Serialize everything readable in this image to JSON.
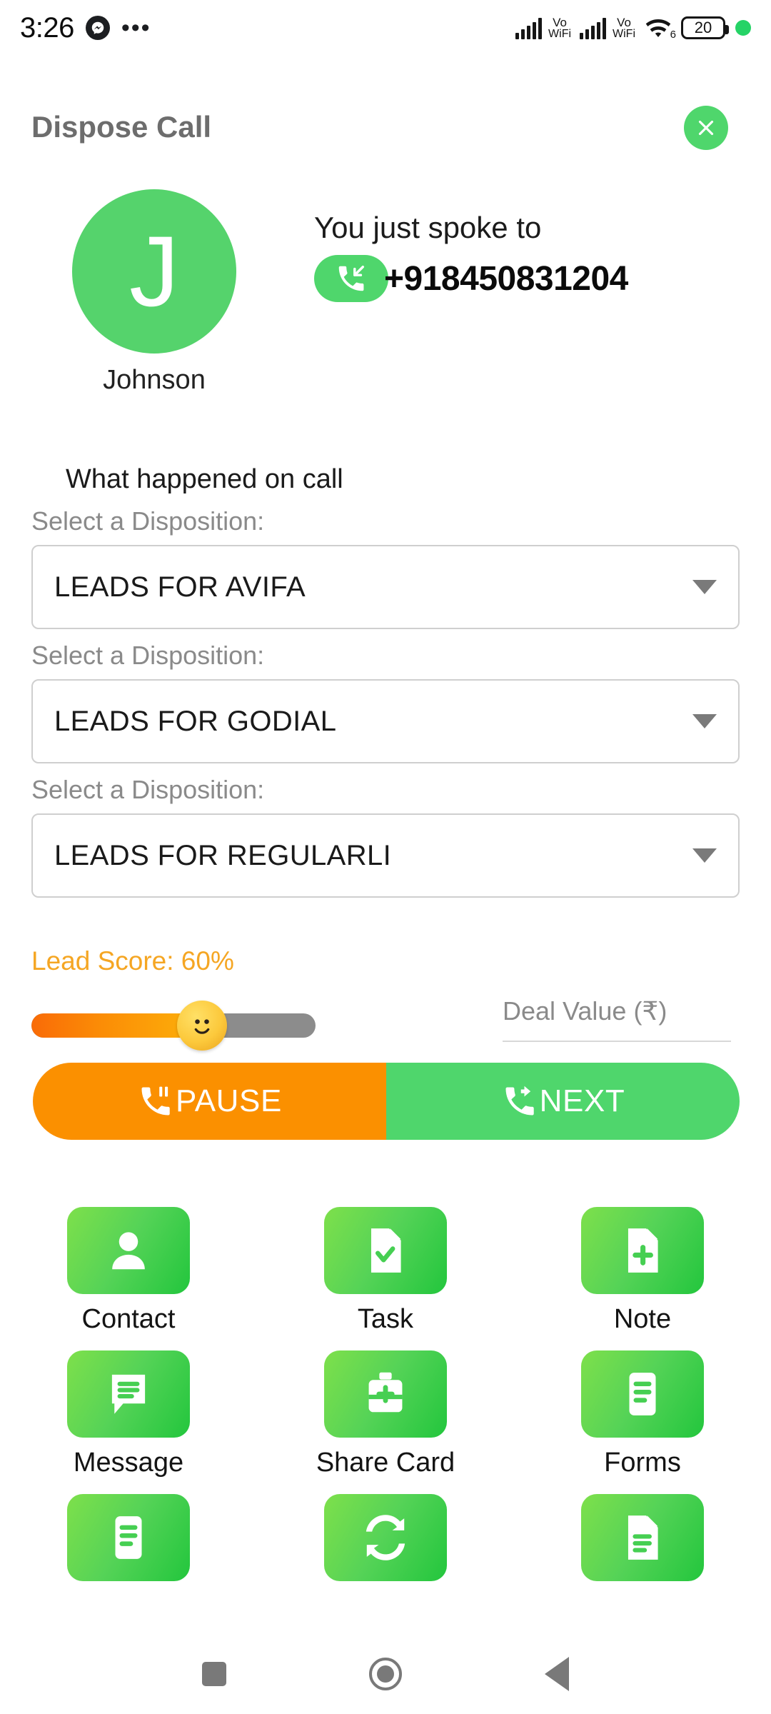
{
  "status_bar": {
    "time": "3:26",
    "messenger_icon": "messenger-icon",
    "overflow_icon": "more-dots-icon",
    "signal_1": {
      "label_top": "Vo",
      "label_bottom": "WiFi"
    },
    "signal_2": {
      "label_top": "Vo",
      "label_bottom": "WiFi"
    },
    "wifi": {
      "icon": "wifi-icon",
      "generation": "6"
    },
    "battery": {
      "level": "20"
    },
    "recording_dot": "green-status-dot"
  },
  "header": {
    "title": "Dispose Call",
    "close_label": "close-icon"
  },
  "caller": {
    "avatar_initial": "J",
    "name": "Johnson",
    "spoke_to_label": "You just spoke to",
    "phone_number": "+918450831204",
    "call_direction_icon": "incoming-call-icon"
  },
  "form": {
    "section_title": "What happened on call",
    "dispositions": [
      {
        "label": "Select a Disposition:",
        "value": "LEADS FOR AVIFA"
      },
      {
        "label": "Select a Disposition:",
        "value": "LEADS FOR GODIAL"
      },
      {
        "label": "Select a Disposition:",
        "value": "LEADS FOR REGULARLI"
      }
    ]
  },
  "lead": {
    "score_label": "Lead Score: 60%",
    "score_percent": 60,
    "deal_value_label": "Deal Value (₹)",
    "deal_value": ""
  },
  "actions": {
    "pause_label": "PAUSE",
    "pause_icon": "phone-pause-icon",
    "pause_color": "#fb9000",
    "next_label": "NEXT",
    "next_icon": "phone-forward-icon",
    "next_color": "#4fd66c"
  },
  "tiles": [
    {
      "label": "Contact",
      "icon": "person-icon"
    },
    {
      "label": "Task",
      "icon": "document-check-icon"
    },
    {
      "label": "Note",
      "icon": "document-plus-icon"
    },
    {
      "label": "Message",
      "icon": "chat-bubble-icon"
    },
    {
      "label": "Share Card",
      "icon": "briefcase-icon"
    },
    {
      "label": "Forms",
      "icon": "list-document-icon"
    },
    {
      "label": "",
      "icon": "list-document-icon"
    },
    {
      "label": "",
      "icon": "sync-refresh-icon"
    },
    {
      "label": "",
      "icon": "document-lines-icon"
    }
  ],
  "navbar": {
    "recents": "square-recents-icon",
    "home": "circle-home-icon",
    "back": "triangle-back-icon"
  },
  "colors": {
    "brand_green": "#4fd66c",
    "tile_green_light": "#7ee04b",
    "tile_green_dark": "#23c63d",
    "orange": "#fb9000",
    "lead_score_orange": "#f5a623",
    "track_gray": "#8c8c8c"
  }
}
